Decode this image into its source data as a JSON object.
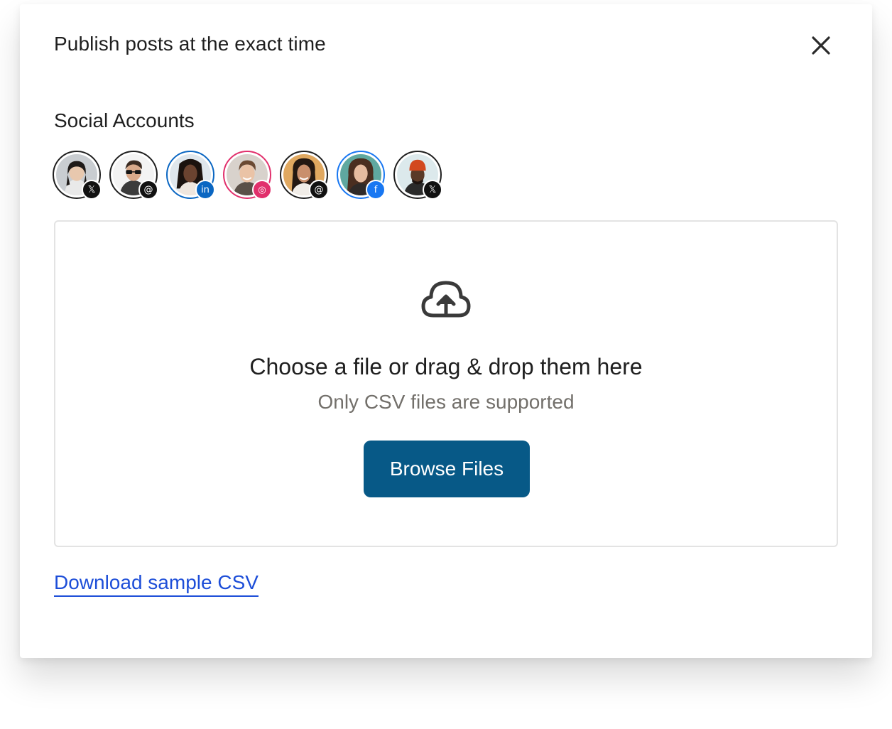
{
  "modal": {
    "title": "Publish posts at the exact time",
    "close_icon": "close-icon"
  },
  "accounts": {
    "label": "Social Accounts",
    "items": [
      {
        "platform": "X",
        "badge_glyph": "𝕏",
        "ring_color": "#1f1f1f",
        "badge_color": "#111111"
      },
      {
        "platform": "Threads",
        "badge_glyph": "@",
        "ring_color": "#1f1f1f",
        "badge_color": "#111111"
      },
      {
        "platform": "LinkedIn",
        "badge_glyph": "in",
        "ring_color": "#0a66c2",
        "badge_color": "#0a66c2"
      },
      {
        "platform": "Instagram",
        "badge_glyph": "◎",
        "ring_color": "#e1306c",
        "badge_color": "#e1306c"
      },
      {
        "platform": "Threads",
        "badge_glyph": "@",
        "ring_color": "#1f1f1f",
        "badge_color": "#111111"
      },
      {
        "platform": "Facebook",
        "badge_glyph": "f",
        "ring_color": "#1877f2",
        "badge_color": "#1877f2"
      },
      {
        "platform": "X",
        "badge_glyph": "𝕏",
        "ring_color": "#1f1f1f",
        "badge_color": "#111111"
      }
    ]
  },
  "dropzone": {
    "icon": "cloud-upload-icon",
    "heading": "Choose a file or drag & drop them here",
    "subtext": "Only CSV files are supported",
    "browse_label": "Browse Files"
  },
  "footer": {
    "download_label": "Download sample CSV"
  },
  "colors": {
    "primary_button": "#075987",
    "link": "#1d4ed8",
    "muted_text": "#73706b"
  }
}
